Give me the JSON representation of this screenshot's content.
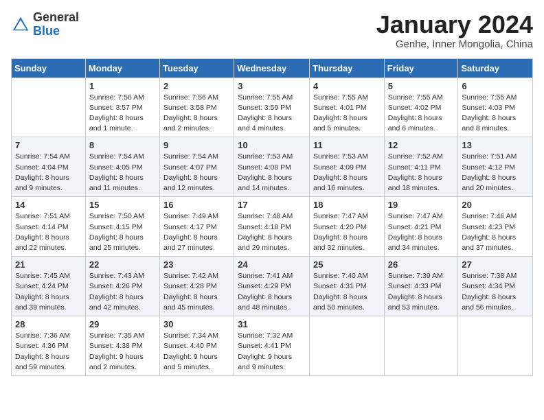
{
  "header": {
    "logo_line1": "General",
    "logo_line2": "Blue",
    "title": "January 2024",
    "subtitle": "Genhe, Inner Mongolia, China"
  },
  "days_of_week": [
    "Sunday",
    "Monday",
    "Tuesday",
    "Wednesday",
    "Thursday",
    "Friday",
    "Saturday"
  ],
  "weeks": [
    [
      {
        "num": "",
        "info": ""
      },
      {
        "num": "1",
        "info": "Sunrise: 7:56 AM\nSunset: 3:57 PM\nDaylight: 8 hours\nand 1 minute."
      },
      {
        "num": "2",
        "info": "Sunrise: 7:56 AM\nSunset: 3:58 PM\nDaylight: 8 hours\nand 2 minutes."
      },
      {
        "num": "3",
        "info": "Sunrise: 7:55 AM\nSunset: 3:59 PM\nDaylight: 8 hours\nand 4 minutes."
      },
      {
        "num": "4",
        "info": "Sunrise: 7:55 AM\nSunset: 4:01 PM\nDaylight: 8 hours\nand 5 minutes."
      },
      {
        "num": "5",
        "info": "Sunrise: 7:55 AM\nSunset: 4:02 PM\nDaylight: 8 hours\nand 6 minutes."
      },
      {
        "num": "6",
        "info": "Sunrise: 7:55 AM\nSunset: 4:03 PM\nDaylight: 8 hours\nand 8 minutes."
      }
    ],
    [
      {
        "num": "7",
        "info": "Sunrise: 7:54 AM\nSunset: 4:04 PM\nDaylight: 8 hours\nand 9 minutes."
      },
      {
        "num": "8",
        "info": "Sunrise: 7:54 AM\nSunset: 4:05 PM\nDaylight: 8 hours\nand 11 minutes."
      },
      {
        "num": "9",
        "info": "Sunrise: 7:54 AM\nSunset: 4:07 PM\nDaylight: 8 hours\nand 12 minutes."
      },
      {
        "num": "10",
        "info": "Sunrise: 7:53 AM\nSunset: 4:08 PM\nDaylight: 8 hours\nand 14 minutes."
      },
      {
        "num": "11",
        "info": "Sunrise: 7:53 AM\nSunset: 4:09 PM\nDaylight: 8 hours\nand 16 minutes."
      },
      {
        "num": "12",
        "info": "Sunrise: 7:52 AM\nSunset: 4:11 PM\nDaylight: 8 hours\nand 18 minutes."
      },
      {
        "num": "13",
        "info": "Sunrise: 7:51 AM\nSunset: 4:12 PM\nDaylight: 8 hours\nand 20 minutes."
      }
    ],
    [
      {
        "num": "14",
        "info": "Sunrise: 7:51 AM\nSunset: 4:14 PM\nDaylight: 8 hours\nand 22 minutes."
      },
      {
        "num": "15",
        "info": "Sunrise: 7:50 AM\nSunset: 4:15 PM\nDaylight: 8 hours\nand 25 minutes."
      },
      {
        "num": "16",
        "info": "Sunrise: 7:49 AM\nSunset: 4:17 PM\nDaylight: 8 hours\nand 27 minutes."
      },
      {
        "num": "17",
        "info": "Sunrise: 7:48 AM\nSunset: 4:18 PM\nDaylight: 8 hours\nand 29 minutes."
      },
      {
        "num": "18",
        "info": "Sunrise: 7:47 AM\nSunset: 4:20 PM\nDaylight: 8 hours\nand 32 minutes."
      },
      {
        "num": "19",
        "info": "Sunrise: 7:47 AM\nSunset: 4:21 PM\nDaylight: 8 hours\nand 34 minutes."
      },
      {
        "num": "20",
        "info": "Sunrise: 7:46 AM\nSunset: 4:23 PM\nDaylight: 8 hours\nand 37 minutes."
      }
    ],
    [
      {
        "num": "21",
        "info": "Sunrise: 7:45 AM\nSunset: 4:24 PM\nDaylight: 8 hours\nand 39 minutes."
      },
      {
        "num": "22",
        "info": "Sunrise: 7:43 AM\nSunset: 4:26 PM\nDaylight: 8 hours\nand 42 minutes."
      },
      {
        "num": "23",
        "info": "Sunrise: 7:42 AM\nSunset: 4:28 PM\nDaylight: 8 hours\nand 45 minutes."
      },
      {
        "num": "24",
        "info": "Sunrise: 7:41 AM\nSunset: 4:29 PM\nDaylight: 8 hours\nand 48 minutes."
      },
      {
        "num": "25",
        "info": "Sunrise: 7:40 AM\nSunset: 4:31 PM\nDaylight: 8 hours\nand 50 minutes."
      },
      {
        "num": "26",
        "info": "Sunrise: 7:39 AM\nSunset: 4:33 PM\nDaylight: 8 hours\nand 53 minutes."
      },
      {
        "num": "27",
        "info": "Sunrise: 7:38 AM\nSunset: 4:34 PM\nDaylight: 8 hours\nand 56 minutes."
      }
    ],
    [
      {
        "num": "28",
        "info": "Sunrise: 7:36 AM\nSunset: 4:36 PM\nDaylight: 8 hours\nand 59 minutes."
      },
      {
        "num": "29",
        "info": "Sunrise: 7:35 AM\nSunset: 4:38 PM\nDaylight: 9 hours\nand 2 minutes."
      },
      {
        "num": "30",
        "info": "Sunrise: 7:34 AM\nSunset: 4:40 PM\nDaylight: 9 hours\nand 5 minutes."
      },
      {
        "num": "31",
        "info": "Sunrise: 7:32 AM\nSunset: 4:41 PM\nDaylight: 9 hours\nand 9 minutes."
      },
      {
        "num": "",
        "info": ""
      },
      {
        "num": "",
        "info": ""
      },
      {
        "num": "",
        "info": ""
      }
    ]
  ]
}
